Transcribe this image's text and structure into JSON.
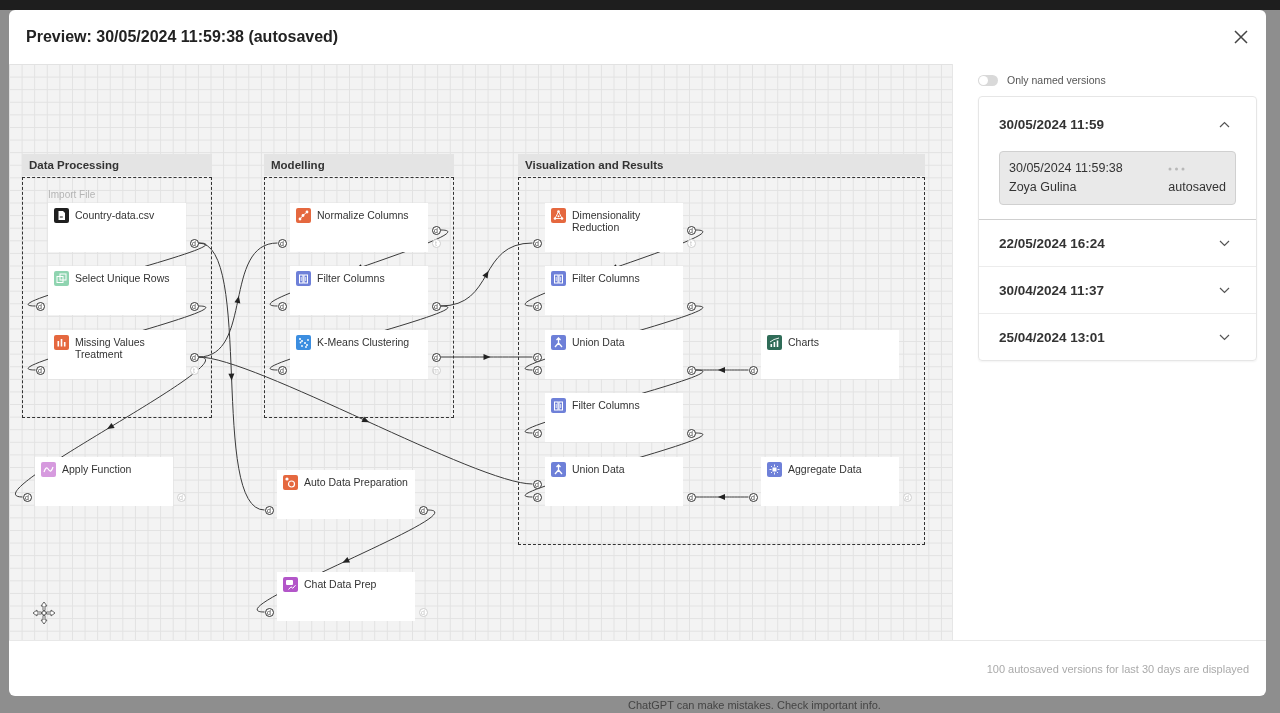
{
  "dialog": {
    "title": "Preview: 30/05/2024 11:59:38 (autosaved)"
  },
  "canvas": {
    "groups": [
      {
        "title": "Data Processing",
        "nodes": [
          {
            "label": "Country-data.csv",
            "kind": "file",
            "caption": "Import File",
            "outputs": [
              {
                "label": "d",
                "connected": true
              }
            ]
          },
          {
            "label": "Select Unique Rows",
            "kind": "select",
            "inputs": [
              {
                "label": "d",
                "connected": true
              }
            ],
            "outputs": [
              {
                "label": "d",
                "connected": true
              }
            ]
          },
          {
            "label": "Missing Values Treatment",
            "kind": "missing",
            "inputs": [
              {
                "label": "d",
                "connected": true
              }
            ],
            "outputs": [
              {
                "label": "d",
                "connected": true
              },
              {
                "label": "t",
                "connected": false
              }
            ]
          }
        ]
      },
      {
        "title": "Modelling",
        "nodes": [
          {
            "label": "Normalize Columns",
            "kind": "normalize",
            "inputs": [
              {
                "label": "d",
                "connected": true
              }
            ],
            "outputs": [
              {
                "label": "d",
                "connected": true
              },
              {
                "label": "t",
                "connected": false
              }
            ]
          },
          {
            "label": "Filter Columns",
            "kind": "filter",
            "inputs": [
              {
                "label": "d",
                "connected": true
              }
            ],
            "outputs": [
              {
                "label": "d",
                "connected": true
              }
            ]
          },
          {
            "label": "K-Means Clustering",
            "kind": "cluster",
            "inputs": [
              {
                "label": "d",
                "connected": true
              }
            ],
            "outputs": [
              {
                "label": "d",
                "connected": true
              },
              {
                "label": "m",
                "connected": false
              }
            ]
          }
        ]
      },
      {
        "title": "Visualization and Results",
        "nodes": [
          {
            "label": "Dimensionality Reduction",
            "kind": "reduction",
            "inputs": [
              {
                "label": "d",
                "connected": true
              }
            ],
            "outputs": [
              {
                "label": "d",
                "connected": true
              },
              {
                "label": "t",
                "connected": false
              }
            ]
          },
          {
            "label": "Filter Columns",
            "kind": "filter",
            "inputs": [
              {
                "label": "d",
                "connected": true
              }
            ],
            "outputs": [
              {
                "label": "d",
                "connected": true
              }
            ]
          },
          {
            "label": "Union Data",
            "kind": "union",
            "inputs": [
              {
                "label": "d",
                "connected": true
              },
              {
                "label": "d",
                "connected": true
              }
            ],
            "outputs": [
              {
                "label": "d",
                "connected": true
              }
            ]
          },
          {
            "label": "Filter Columns",
            "kind": "filter",
            "inputs": [
              {
                "label": "d",
                "connected": true
              }
            ],
            "outputs": [
              {
                "label": "d",
                "connected": true
              }
            ]
          },
          {
            "label": "Union Data",
            "kind": "union",
            "inputs": [
              {
                "label": "d",
                "connected": true
              },
              {
                "label": "d",
                "connected": true
              }
            ],
            "outputs": [
              {
                "label": "d",
                "connected": true
              }
            ]
          },
          {
            "label": "Charts",
            "kind": "chart",
            "inputs": [
              {
                "label": "d",
                "connected": true
              }
            ]
          },
          {
            "label": "Aggregate Data",
            "kind": "aggregate",
            "inputs": [
              {
                "label": "d",
                "connected": true
              }
            ],
            "outputs": [
              {
                "label": "d",
                "connected": false
              }
            ]
          }
        ]
      }
    ],
    "nodes": [
      {
        "label": "Apply Function",
        "kind": "function",
        "inputs": [
          {
            "label": "d",
            "connected": true
          }
        ],
        "outputs": [
          {
            "label": "d",
            "connected": false
          }
        ]
      },
      {
        "label": "Auto Data Preparation",
        "kind": "autoprep",
        "inputs": [
          {
            "label": "d",
            "connected": true
          }
        ],
        "outputs": [
          {
            "label": "d",
            "connected": true
          }
        ]
      },
      {
        "label": "Chat Data Prep",
        "kind": "chat",
        "inputs": [
          {
            "label": "d",
            "connected": true
          }
        ],
        "outputs": [
          {
            "label": "d",
            "connected": false
          }
        ]
      }
    ]
  },
  "version_panel": {
    "only_named": {
      "label": "Only named versions",
      "on": false
    },
    "versions": [
      {
        "date": "30/05/2024 11:59",
        "expanded": true,
        "items": [
          {
            "timestamp": "30/05/2024 11:59:38",
            "author": "Zoya Gulina",
            "status": "autosaved",
            "selected": true
          }
        ]
      },
      {
        "date": "22/05/2024 16:24",
        "expanded": false
      },
      {
        "date": "30/04/2024 11:37",
        "expanded": false
      },
      {
        "date": "25/04/2024 13:01",
        "expanded": false
      }
    ]
  },
  "footer": {
    "note": "100 autosaved versions for last 30 days are displayed"
  },
  "backdrop": {
    "text": "ChatGPT can make mistakes. Check important info."
  }
}
